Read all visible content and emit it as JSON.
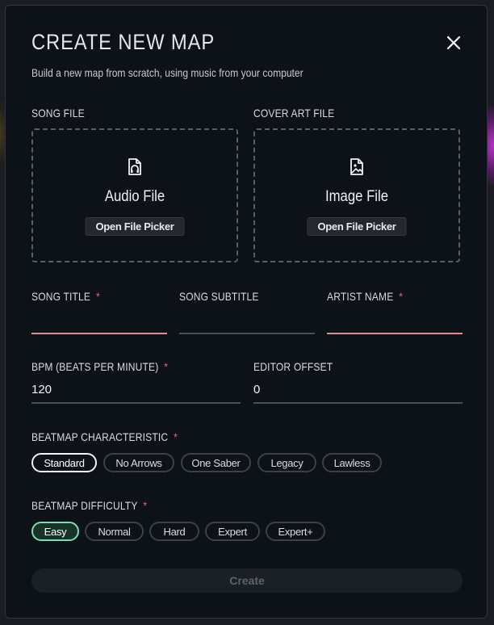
{
  "modal": {
    "title": "CREATE NEW MAP",
    "subtitle": "Build a new map from scratch, using music from your computer"
  },
  "song_file": {
    "label": "SONG FILE",
    "title": "Audio File",
    "button": "Open File Picker",
    "icon": "audio-file-icon"
  },
  "cover_file": {
    "label": "COVER ART FILE",
    "title": "Image File",
    "button": "Open File Picker",
    "icon": "image-file-icon"
  },
  "fields": {
    "song_title": {
      "label": "SONG TITLE",
      "required": "*",
      "value": ""
    },
    "song_subtitle": {
      "label": "SONG SUBTITLE",
      "value": ""
    },
    "artist_name": {
      "label": "ARTIST NAME",
      "required": "*",
      "value": ""
    },
    "bpm": {
      "label": "BPM (BEATS PER MINUTE)",
      "required": "*",
      "value": "120"
    },
    "editor_offset": {
      "label": "EDITOR OFFSET",
      "value": "0"
    }
  },
  "characteristic": {
    "label": "BEATMAP CHARACTERISTIC",
    "required": "*",
    "options": [
      "Standard",
      "No Arrows",
      "One Saber",
      "Legacy",
      "Lawless"
    ],
    "selected": "Standard"
  },
  "difficulty": {
    "label": "BEATMAP DIFFICULTY",
    "required": "*",
    "options": [
      "Easy",
      "Normal",
      "Hard",
      "Expert",
      "Expert+"
    ],
    "selected": "Easy"
  },
  "create_button": "Create",
  "colors": {
    "background": "#0d1118",
    "error_underline": "#e28d8d",
    "required_star": "#e0676b",
    "selected_difficulty": "#7ddbb5"
  }
}
